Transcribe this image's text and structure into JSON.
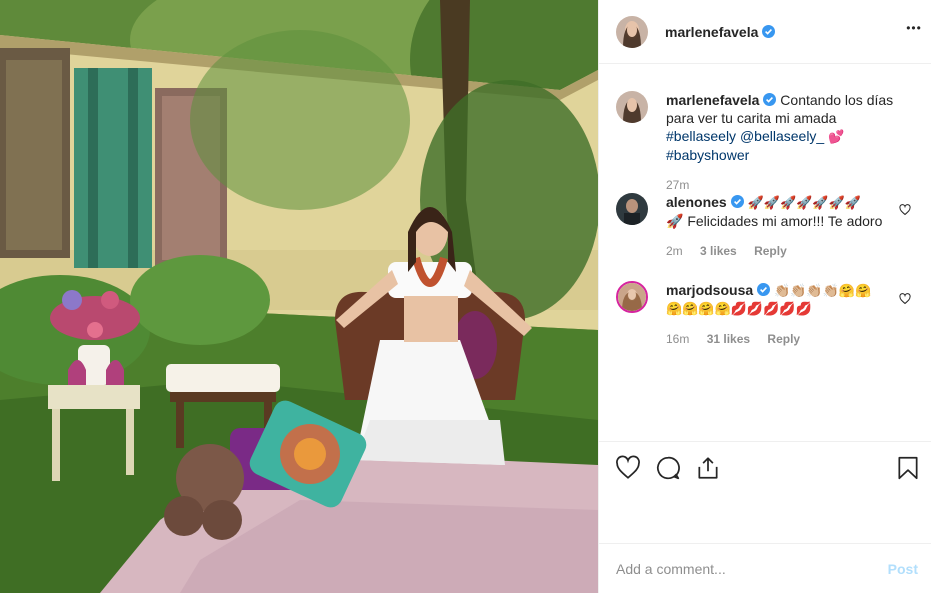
{
  "post": {
    "author": "marlenefavela",
    "more_glyph": "•••",
    "caption": {
      "username": "marlenefavela",
      "text": "Contando los días para ver tu carita mi amada",
      "hashtag1": "#bellaseely",
      "mention": "@bellaseely_",
      "heart": "💕",
      "hashtag2": "#babyshower",
      "time": "27m"
    }
  },
  "comments": [
    {
      "username": "alenones",
      "emojis": "🚀🚀🚀🚀🚀🚀🚀",
      "text": "🚀 Felicidades mi amor!!! Te adoro",
      "time": "2m",
      "likes": "3 likes",
      "reply": "Reply"
    },
    {
      "username": "marjodsousa",
      "emojis": "👏🏼👏🏼👏🏼👏🏼🤗🤗",
      "text": "🤗🤗🤗🤗💋💋💋💋💋",
      "time": "16m",
      "likes": "31 likes",
      "reply": "Reply"
    }
  ],
  "actions": {
    "icons": [
      "heart-icon",
      "comment-icon",
      "share-icon",
      "bookmark-icon"
    ]
  },
  "add_comment": {
    "placeholder": "Add a comment...",
    "post_label": "Post"
  },
  "colors": {
    "link": "#00376b",
    "verified": "#3897f0",
    "muted": "#8e8e8e",
    "post_disabled": "#b2dffc"
  }
}
